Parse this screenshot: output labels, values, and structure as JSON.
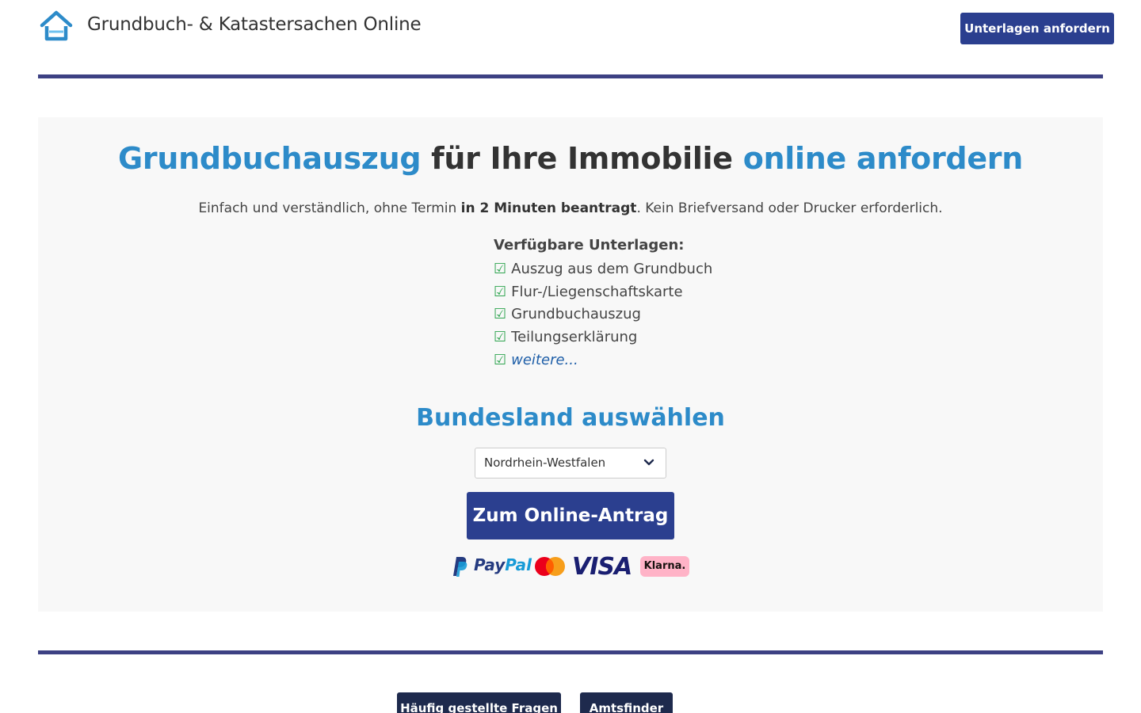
{
  "header": {
    "site_title": "Grundbuch- & Katastersachen Online",
    "cta_label": "Unterlagen anfordern"
  },
  "hero": {
    "title_part1": "Grundbuchauszug",
    "title_part2": " für Ihre Immobilie ",
    "title_part3": "online anfordern",
    "subtitle_part1": "Einfach und verständlich, ohne Termin ",
    "subtitle_bold": "in 2 Minuten beantragt",
    "subtitle_part2": ". Kein Briefversand oder Drucker erforderlich.",
    "docs_heading": "Verfügbare Unterlagen:",
    "docs": [
      "Auszug aus dem Grundbuch",
      "Flur-/Liegenschaftskarte",
      "Grundbuchauszug",
      "Teilungserklärung"
    ],
    "docs_more": "weitere...",
    "check_glyph": "☑",
    "state_heading": "Bundesland auswählen",
    "state_selected": "Nordrhein-Westfalen",
    "submit_label": "Zum Online-Antrag"
  },
  "payments": {
    "paypal_a": "Pay",
    "paypal_b": "Pal",
    "visa": "VISA",
    "klarna": "Klarna."
  },
  "footer": {
    "faq_label": "Häufig gestellte Fragen",
    "amtsfinder_label": "Amtsfinder"
  },
  "colors": {
    "primary": "#2b3f8f",
    "accent_blue": "#2d8bc9",
    "rule": "#3d4183",
    "check": "#2ea44f",
    "hero_bg": "#f8f8f8"
  }
}
